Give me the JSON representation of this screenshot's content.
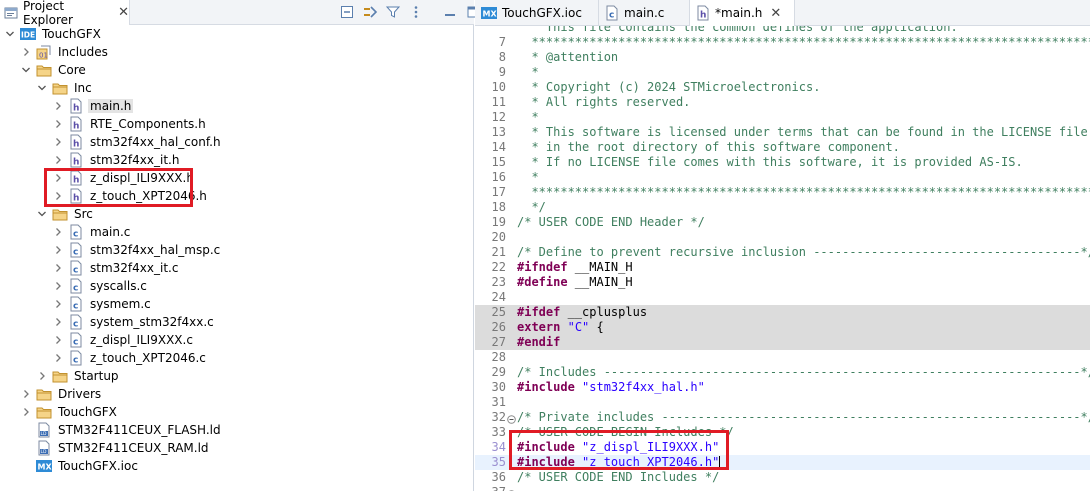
{
  "project_explorer": {
    "title": "Project Explorer",
    "close_glyph": "✕",
    "toolbar_icons": [
      "collapse-all-icon",
      "link-with-editor-icon",
      "filter-icon",
      "view-menu-icon",
      "minimize-icon",
      "maximize-icon"
    ],
    "tree": [
      {
        "label": "TouchGFX",
        "icon": "ide-project-icon",
        "depth": 0,
        "twisty": "open"
      },
      {
        "label": "Includes",
        "icon": "includes-icon",
        "depth": 1,
        "twisty": "closed"
      },
      {
        "label": "Core",
        "icon": "folder-icon",
        "depth": 1,
        "twisty": "open"
      },
      {
        "label": "Inc",
        "icon": "folder-icon",
        "depth": 2,
        "twisty": "open"
      },
      {
        "label": "main.h",
        "icon": "h-file-icon",
        "depth": 3,
        "twisty": "closed",
        "selected": true
      },
      {
        "label": "RTE_Components.h",
        "icon": "h-file-icon",
        "depth": 3,
        "twisty": "closed"
      },
      {
        "label": "stm32f4xx_hal_conf.h",
        "icon": "h-file-icon",
        "depth": 3,
        "twisty": "closed"
      },
      {
        "label": "stm32f4xx_it.h",
        "icon": "h-file-icon",
        "depth": 3,
        "twisty": "closed"
      },
      {
        "label": "z_displ_ILI9XXX.h",
        "icon": "h-file-icon",
        "depth": 3,
        "twisty": "closed"
      },
      {
        "label": "z_touch_XPT2046.h",
        "icon": "h-file-icon",
        "depth": 3,
        "twisty": "closed"
      },
      {
        "label": "Src",
        "icon": "folder-icon",
        "depth": 2,
        "twisty": "open"
      },
      {
        "label": "main.c",
        "icon": "c-file-icon",
        "depth": 3,
        "twisty": "closed"
      },
      {
        "label": "stm32f4xx_hal_msp.c",
        "icon": "c-file-icon",
        "depth": 3,
        "twisty": "closed"
      },
      {
        "label": "stm32f4xx_it.c",
        "icon": "c-file-icon",
        "depth": 3,
        "twisty": "closed"
      },
      {
        "label": "syscalls.c",
        "icon": "c-file-icon",
        "depth": 3,
        "twisty": "closed"
      },
      {
        "label": "sysmem.c",
        "icon": "c-file-icon",
        "depth": 3,
        "twisty": "closed"
      },
      {
        "label": "system_stm32f4xx.c",
        "icon": "c-file-icon",
        "depth": 3,
        "twisty": "closed"
      },
      {
        "label": "z_displ_ILI9XXX.c",
        "icon": "c-file-icon",
        "depth": 3,
        "twisty": "closed"
      },
      {
        "label": "z_touch_XPT2046.c",
        "icon": "c-file-icon",
        "depth": 3,
        "twisty": "closed"
      },
      {
        "label": "Startup",
        "icon": "folder-icon",
        "depth": 2,
        "twisty": "closed"
      },
      {
        "label": "Drivers",
        "icon": "folder-icon",
        "depth": 1,
        "twisty": "closed"
      },
      {
        "label": "TouchGFX",
        "icon": "folder-icon",
        "depth": 1,
        "twisty": "closed"
      },
      {
        "label": "STM32F411CEUX_FLASH.ld",
        "icon": "ld-file-icon",
        "depth": 1,
        "twisty": "none"
      },
      {
        "label": "STM32F411CEUX_RAM.ld",
        "icon": "ld-file-icon",
        "depth": 1,
        "twisty": "none"
      },
      {
        "label": "TouchGFX.ioc",
        "icon": "mx-file-icon",
        "depth": 1,
        "twisty": "none"
      }
    ]
  },
  "editor_tabs": [
    {
      "label": "TouchGFX.ioc",
      "icon": "mx-file-icon",
      "active": false,
      "closable": false
    },
    {
      "label": "main.c",
      "icon": "c-file-icon",
      "active": false,
      "closable": false
    },
    {
      "label": "*main.h",
      "icon": "h-file-icon",
      "active": true,
      "closable": true
    }
  ],
  "editor_tab_close_glyph": "✕",
  "code": [
    {
      "n": "",
      "fold": false,
      "style": "",
      "tokens": [
        {
          "c": "cm",
          "t": "    This file contains the common defines of the application."
        }
      ]
    },
    {
      "n": "7",
      "fold": false,
      "style": "",
      "tokens": [
        {
          "c": "cm",
          "t": "  ******************************************************************************"
        }
      ]
    },
    {
      "n": "8",
      "fold": false,
      "style": "",
      "tokens": [
        {
          "c": "cm",
          "t": "  * @attention"
        }
      ]
    },
    {
      "n": "9",
      "fold": false,
      "style": "",
      "tokens": [
        {
          "c": "cm",
          "t": "  *"
        }
      ]
    },
    {
      "n": "10",
      "fold": false,
      "style": "",
      "tokens": [
        {
          "c": "cm",
          "t": "  * Copyright (c) 2024 STMicroelectronics."
        }
      ]
    },
    {
      "n": "11",
      "fold": false,
      "style": "",
      "tokens": [
        {
          "c": "cm",
          "t": "  * All rights reserved."
        }
      ]
    },
    {
      "n": "12",
      "fold": false,
      "style": "",
      "tokens": [
        {
          "c": "cm",
          "t": "  *"
        }
      ]
    },
    {
      "n": "13",
      "fold": false,
      "style": "",
      "tokens": [
        {
          "c": "cm",
          "t": "  * This software is licensed under terms that can be found in the LICENSE file"
        }
      ]
    },
    {
      "n": "14",
      "fold": false,
      "style": "",
      "tokens": [
        {
          "c": "cm",
          "t": "  * in the root directory of this software component."
        }
      ]
    },
    {
      "n": "15",
      "fold": false,
      "style": "",
      "tokens": [
        {
          "c": "cm",
          "t": "  * If no LICENSE file comes with this software, it is provided AS-IS."
        }
      ]
    },
    {
      "n": "16",
      "fold": false,
      "style": "",
      "tokens": [
        {
          "c": "cm",
          "t": "  *"
        }
      ]
    },
    {
      "n": "17",
      "fold": false,
      "style": "",
      "tokens": [
        {
          "c": "cm",
          "t": "  ******************************************************************************"
        }
      ]
    },
    {
      "n": "18",
      "fold": false,
      "style": "",
      "tokens": [
        {
          "c": "cm",
          "t": "  */"
        }
      ]
    },
    {
      "n": "19",
      "fold": false,
      "style": "",
      "tokens": [
        {
          "c": "cm",
          "t": "/* USER CODE END Header */"
        }
      ]
    },
    {
      "n": "20",
      "fold": false,
      "style": "",
      "tokens": []
    },
    {
      "n": "21",
      "fold": false,
      "style": "",
      "tokens": [
        {
          "c": "cm",
          "t": "/* Define to prevent recursive inclusion -------------------------------------*/"
        }
      ]
    },
    {
      "n": "22",
      "fold": false,
      "style": "",
      "tokens": [
        {
          "c": "pp",
          "t": "#ifndef"
        },
        {
          "c": "",
          "t": " __MAIN_H"
        }
      ]
    },
    {
      "n": "23",
      "fold": false,
      "style": "",
      "tokens": [
        {
          "c": "pp",
          "t": "#define"
        },
        {
          "c": "",
          "t": " __MAIN_H"
        }
      ]
    },
    {
      "n": "24",
      "fold": false,
      "style": "",
      "tokens": []
    },
    {
      "n": "25",
      "fold": false,
      "style": "hl",
      "tokens": [
        {
          "c": "pp",
          "t": "#ifdef"
        },
        {
          "c": "",
          "t": " __cplusplus"
        }
      ]
    },
    {
      "n": "26",
      "fold": false,
      "style": "hl",
      "tokens": [
        {
          "c": "kw",
          "t": "extern"
        },
        {
          "c": "",
          "t": " "
        },
        {
          "c": "st",
          "t": "\"C\""
        },
        {
          "c": "",
          "t": " {"
        }
      ]
    },
    {
      "n": "27",
      "fold": false,
      "style": "hl",
      "tokens": [
        {
          "c": "pp",
          "t": "#endif"
        }
      ]
    },
    {
      "n": "28",
      "fold": false,
      "style": "",
      "tokens": []
    },
    {
      "n": "29",
      "fold": false,
      "style": "",
      "tokens": [
        {
          "c": "cm",
          "t": "/* Includes ------------------------------------------------------------------*/"
        }
      ]
    },
    {
      "n": "30",
      "fold": false,
      "style": "",
      "tokens": [
        {
          "c": "pp",
          "t": "#include"
        },
        {
          "c": "",
          "t": " "
        },
        {
          "c": "st",
          "t": "\"stm32f4xx_hal.h\""
        }
      ]
    },
    {
      "n": "31",
      "fold": false,
      "style": "",
      "tokens": []
    },
    {
      "n": "32",
      "fold": true,
      "style": "",
      "tokens": [
        {
          "c": "cm",
          "t": "/* Private includes ----------------------------------------------------------*/"
        }
      ]
    },
    {
      "n": "33",
      "fold": false,
      "style": "",
      "tokens": [
        {
          "c": "cm",
          "t": "/* USER CODE BEGIN Includes */"
        }
      ]
    },
    {
      "n": "34",
      "fold": false,
      "style": "",
      "mark": true,
      "tokens": [
        {
          "c": "pp",
          "t": "#include"
        },
        {
          "c": "",
          "t": " "
        },
        {
          "c": "st",
          "t": "\"z_displ_ILI9XXX.h\""
        }
      ]
    },
    {
      "n": "35",
      "fold": false,
      "style": "cur",
      "mark": true,
      "caret": true,
      "tokens": [
        {
          "c": "pp",
          "t": "#include"
        },
        {
          "c": "",
          "t": " "
        },
        {
          "c": "st",
          "t": "\"z_touch_XPT2046.h\""
        }
      ]
    },
    {
      "n": "36",
      "fold": false,
      "style": "",
      "tokens": [
        {
          "c": "cm",
          "t": "/* USER CODE END Includes */"
        }
      ]
    },
    {
      "n": "37",
      "fold": true,
      "style": "",
      "tokens": []
    }
  ]
}
